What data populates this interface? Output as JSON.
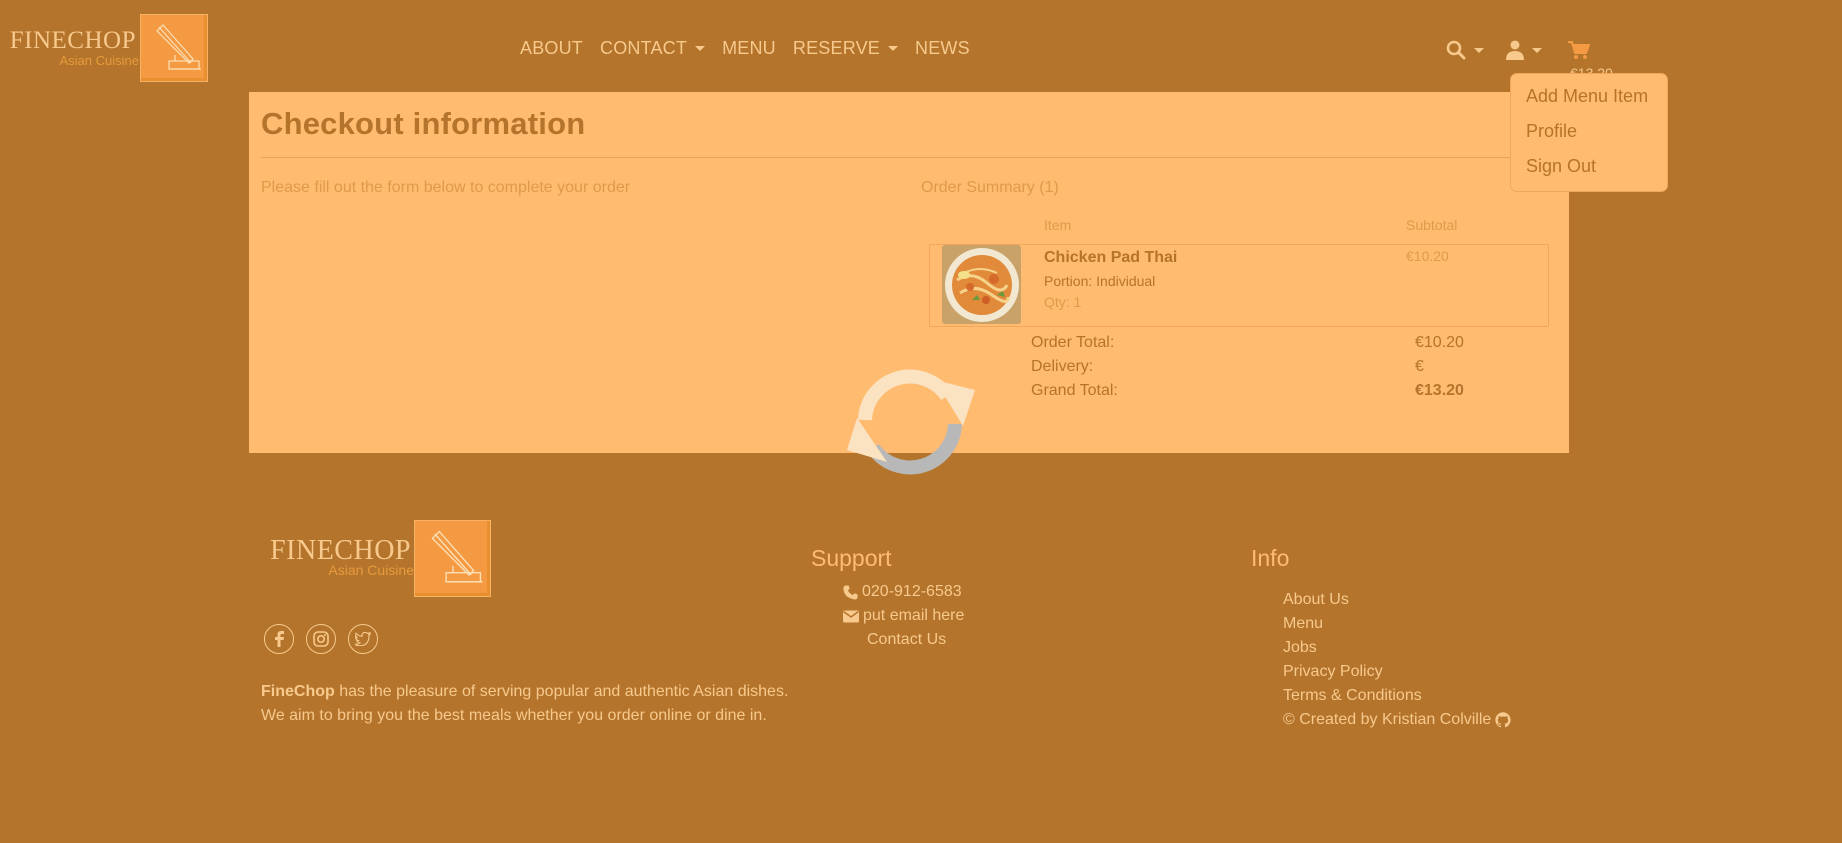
{
  "brand": {
    "name": "FINECHOP",
    "tagline": "Asian Cuisine"
  },
  "nav": {
    "items": [
      {
        "label": "ABOUT",
        "dropdown": false
      },
      {
        "label": "CONTACT",
        "dropdown": true
      },
      {
        "label": "MENU",
        "dropdown": false
      },
      {
        "label": "RESERVE",
        "dropdown": true
      },
      {
        "label": "NEWS",
        "dropdown": false
      }
    ],
    "cart_total": "€13.20",
    "icons": [
      "search-icon",
      "user-icon",
      "cart-icon"
    ]
  },
  "user_menu": {
    "items": [
      "Add Menu Item",
      "Profile",
      "Sign Out"
    ]
  },
  "checkout": {
    "title": "Checkout information",
    "subtitle": "Please fill out the form below to complete your order",
    "summary_label": "Order Summary (1)",
    "col_item": "Item",
    "col_subtotal": "Subtotal",
    "item": {
      "name": "Chicken Pad Thai",
      "portion": "Portion: Individual",
      "qty": "Qty: 1",
      "price": "€10.20"
    },
    "totals": {
      "order_total_label": "Order Total:",
      "order_total": "€10.20",
      "delivery_label": "Delivery:",
      "delivery": "€",
      "grand_total_label": "Grand Total:",
      "grand_total": "€13.20"
    }
  },
  "footer": {
    "about_brand": "FineChop",
    "about_text_1": " has the pleasure of serving popular and authentic Asian dishes.",
    "about_text_2": "We aim to bring you the best meals whether you order online or dine in.",
    "support": {
      "heading": "Support",
      "phone": "020-912-6583",
      "email": "put email here",
      "contact": "Contact Us"
    },
    "info": {
      "heading": "Info",
      "links": [
        "About Us",
        "Menu",
        "Jobs",
        "Privacy Policy",
        "Terms & Conditions",
        "© Created by Kristian Colville"
      ]
    },
    "social_icons": [
      "facebook-icon",
      "instagram-icon",
      "twitter-icon"
    ]
  },
  "colors": {
    "background": "#b4742c",
    "card": "#ffbc70",
    "accent": "#f49a43",
    "text_light": "#f7c98c"
  }
}
